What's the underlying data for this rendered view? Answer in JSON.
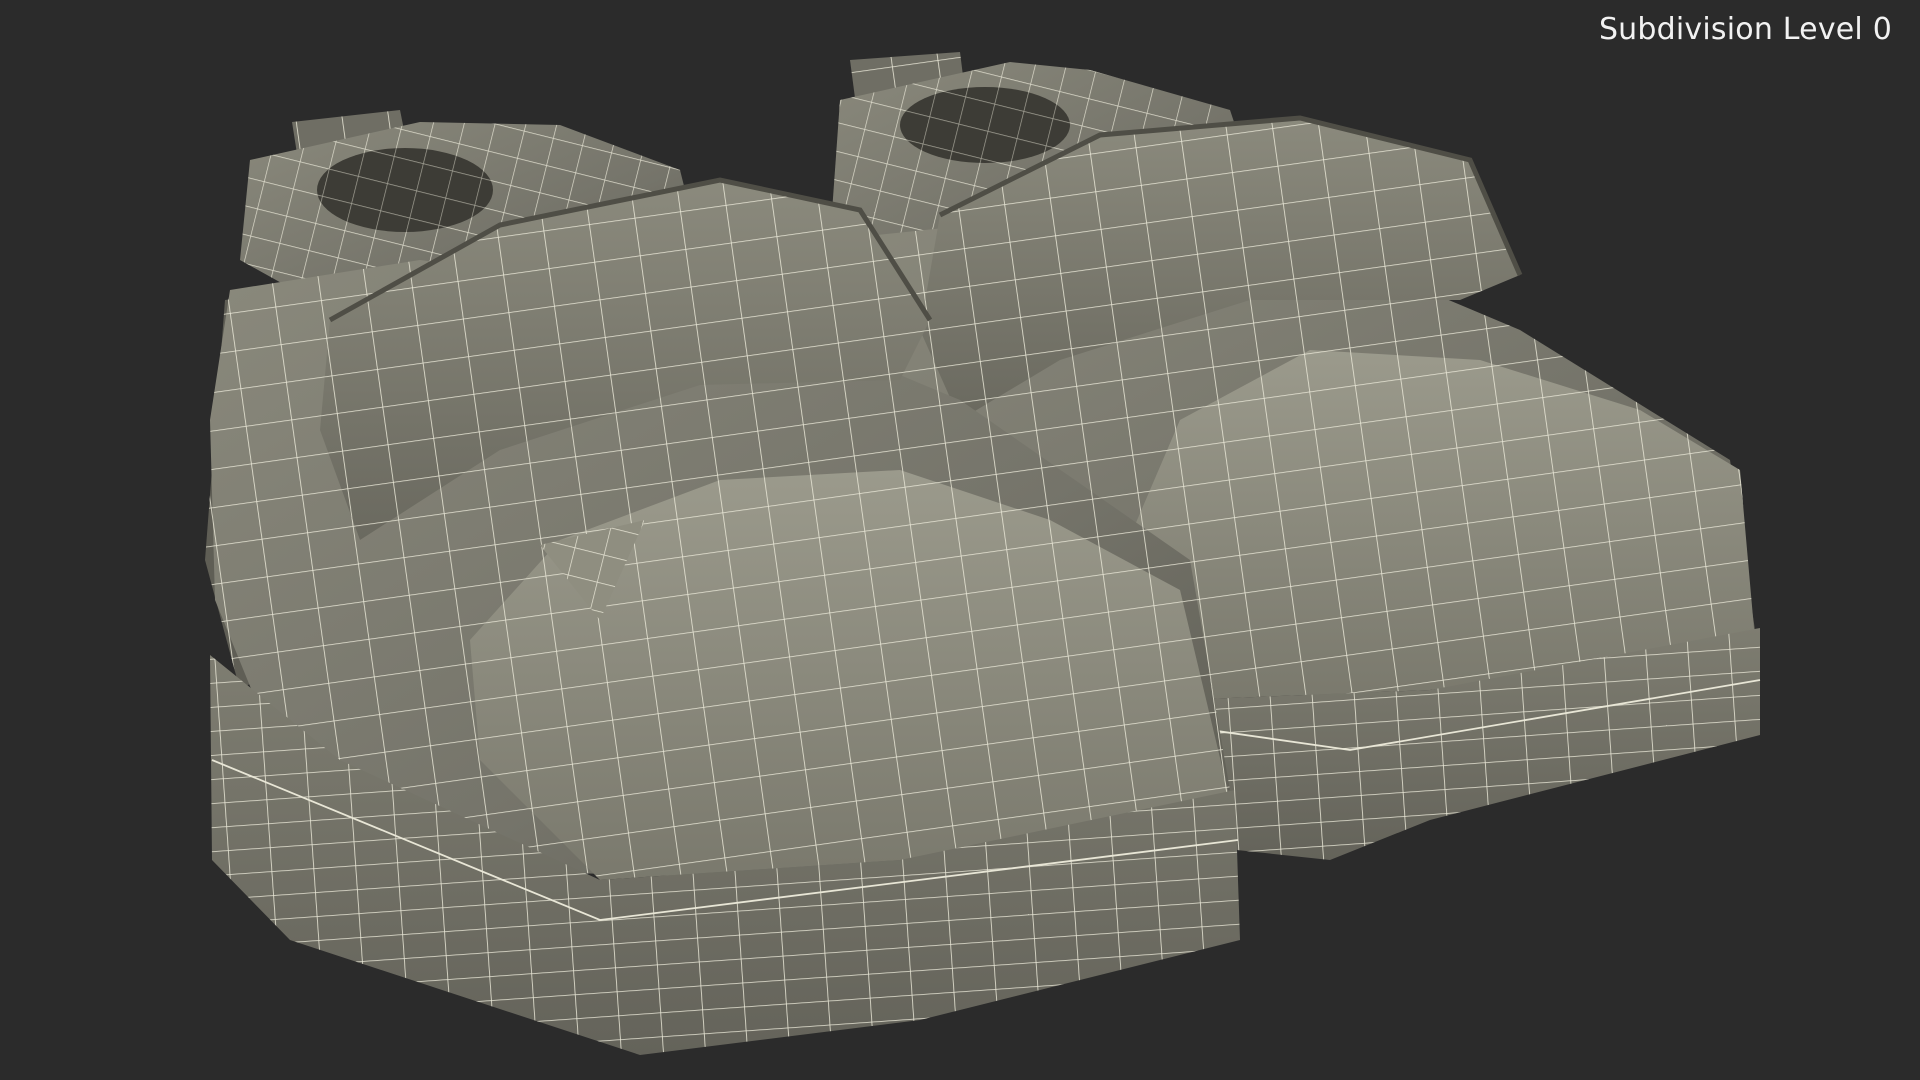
{
  "viewport": {
    "overlay_label": "Subdivision Level 0",
    "colors": {
      "background": "#2b2b2b",
      "mesh_surface": "#7d7c6f",
      "mesh_shadow": "#4f4e46",
      "mesh_highlight": "#9a998b",
      "wireframe": "#e8e6d6"
    }
  },
  "scene": {
    "objects": [
      "shoe-left",
      "shoe-right"
    ]
  }
}
